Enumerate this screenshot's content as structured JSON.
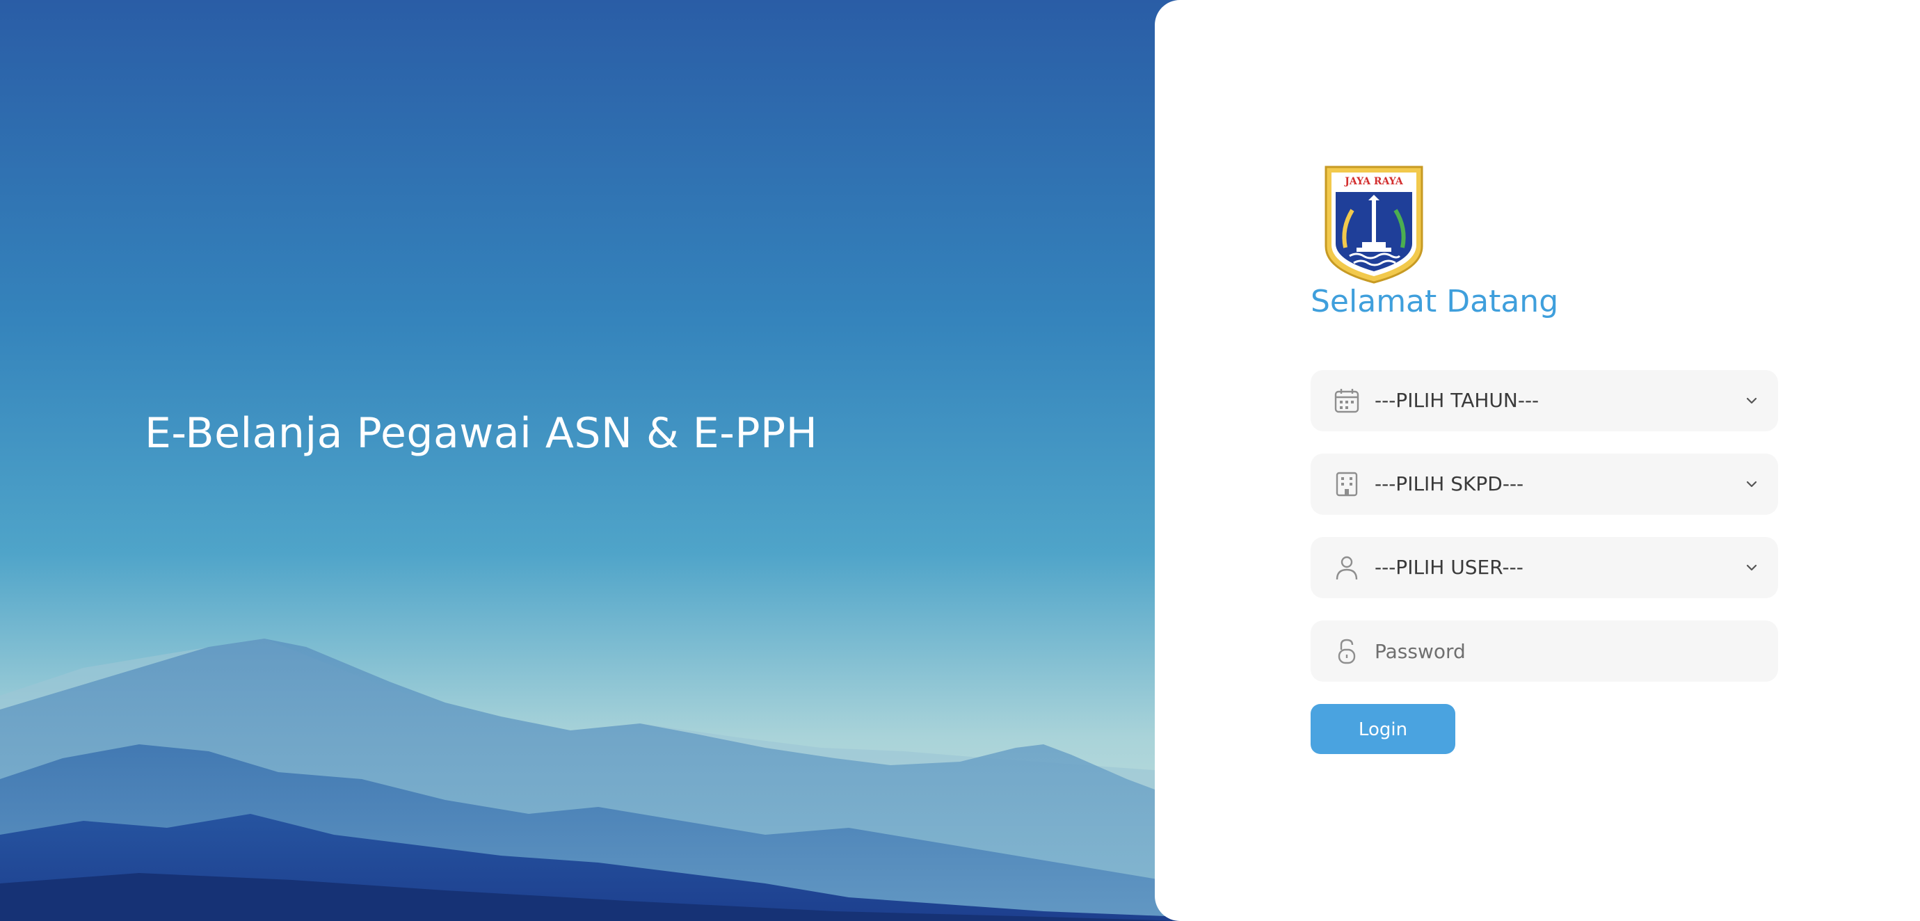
{
  "hero": {
    "title": "E-Belanja Pegawai ASN & E-PPH"
  },
  "login": {
    "logo_text": "JAYA RAYA",
    "welcome": "Selamat Datang",
    "tahun": {
      "value": "---PILIH TAHUN---",
      "icon": "calendar-icon"
    },
    "skpd": {
      "value": "---PILIH SKPD---",
      "icon": "building-icon"
    },
    "user": {
      "value": "---PILIH USER---",
      "icon": "user-icon"
    },
    "password": {
      "placeholder": "Password",
      "icon": "unlock-icon"
    },
    "login_label": "Login"
  },
  "colors": {
    "accent": "#3f9fdc",
    "button": "#4aa3e0",
    "field_bg": "#f6f6f6"
  }
}
